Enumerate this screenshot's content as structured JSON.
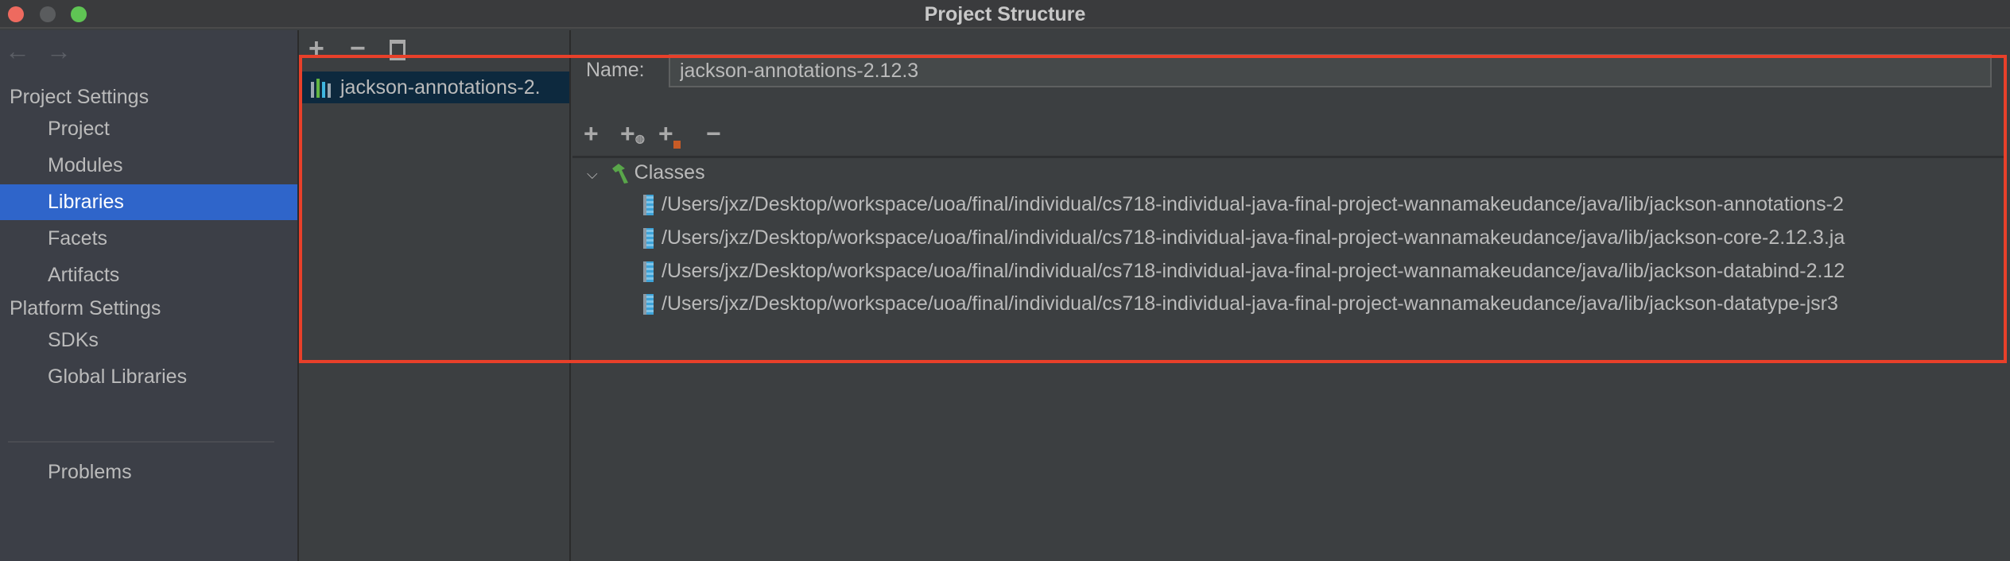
{
  "window": {
    "title": "Project Structure"
  },
  "nav": {
    "back": "←",
    "forward": "→"
  },
  "sidebar": {
    "sections": [
      {
        "label": "Project Settings",
        "items": [
          {
            "label": "Project"
          },
          {
            "label": "Modules"
          },
          {
            "label": "Libraries",
            "selected": true
          },
          {
            "label": "Facets"
          },
          {
            "label": "Artifacts"
          }
        ]
      },
      {
        "label": "Platform Settings",
        "items": [
          {
            "label": "SDKs"
          },
          {
            "label": "Global Libraries"
          }
        ]
      }
    ],
    "problems": "Problems"
  },
  "middle": {
    "toolbar": {
      "add": "+",
      "remove": "−",
      "copy_icon": "copy-icon"
    },
    "libraries": [
      {
        "label": "jackson-annotations-2."
      }
    ]
  },
  "detail": {
    "name_label": "Name:",
    "name_value": "jackson-annotations-2.12.3",
    "toolbar": {
      "add": "+",
      "add_url": "+",
      "add_folder": "+",
      "remove": "−"
    },
    "classes_label": "Classes",
    "paths": [
      "/Users/jxz/Desktop/workspace/uoa/final/individual/cs718-individual-java-final-project-wannamakeudance/java/lib/jackson-annotations-2",
      "/Users/jxz/Desktop/workspace/uoa/final/individual/cs718-individual-java-final-project-wannamakeudance/java/lib/jackson-core-2.12.3.ja",
      "/Users/jxz/Desktop/workspace/uoa/final/individual/cs718-individual-java-final-project-wannamakeudance/java/lib/jackson-databind-2.12",
      "/Users/jxz/Desktop/workspace/uoa/final/individual/cs718-individual-java-final-project-wannamakeudance/java/lib/jackson-datatype-jsr3"
    ]
  },
  "colors": {
    "selection": "#2f65ca",
    "highlight_box": "#e8402a",
    "list_selection": "#0d293e"
  }
}
